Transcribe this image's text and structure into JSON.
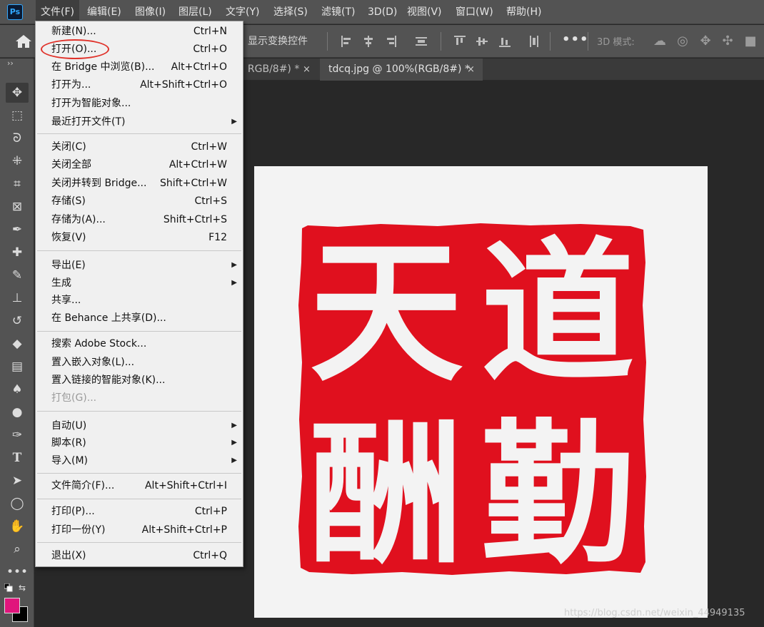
{
  "app": {
    "logo_text": "Ps"
  },
  "menubar": {
    "items": [
      "文件(F)",
      "编辑(E)",
      "图像(I)",
      "图层(L)",
      "文字(Y)",
      "选择(S)",
      "滤镜(T)",
      "3D(D)",
      "视图(V)",
      "窗口(W)",
      "帮助(H)"
    ],
    "active": "文件(F)"
  },
  "options_bar": {
    "transform_controls_label": "显示变换控件",
    "mode_label": "3D 模式:",
    "more": "•••"
  },
  "tabs": [
    {
      "label": ", RGB/8#) *",
      "close": "×"
    },
    {
      "label": "tdcq.jpg @ 100%(RGB/8#) *",
      "close": "×"
    }
  ],
  "file_menu": {
    "groups": [
      [
        {
          "label": "新建(N)...",
          "shortcut": "Ctrl+N"
        },
        {
          "label": "打开(O)...",
          "shortcut": "Ctrl+O",
          "highlighted": true
        },
        {
          "label": "在 Bridge 中浏览(B)...",
          "shortcut": "Alt+Ctrl+O"
        },
        {
          "label": "打开为...",
          "shortcut": "Alt+Shift+Ctrl+O"
        },
        {
          "label": "打开为智能对象..."
        },
        {
          "label": "最近打开文件(T)",
          "submenu": true
        }
      ],
      [
        {
          "label": "关闭(C)",
          "shortcut": "Ctrl+W"
        },
        {
          "label": "关闭全部",
          "shortcut": "Alt+Ctrl+W"
        },
        {
          "label": "关闭并转到 Bridge...",
          "shortcut": "Shift+Ctrl+W"
        },
        {
          "label": "存储(S)",
          "shortcut": "Ctrl+S"
        },
        {
          "label": "存储为(A)...",
          "shortcut": "Shift+Ctrl+S"
        },
        {
          "label": "恢复(V)",
          "shortcut": "F12"
        }
      ],
      [
        {
          "label": "导出(E)",
          "submenu": true
        },
        {
          "label": "生成",
          "submenu": true
        },
        {
          "label": "共享..."
        },
        {
          "label": "在 Behance 上共享(D)..."
        }
      ],
      [
        {
          "label": "搜索 Adobe Stock..."
        },
        {
          "label": "置入嵌入对象(L)..."
        },
        {
          "label": "置入链接的智能对象(K)..."
        },
        {
          "label": "打包(G)...",
          "disabled": true
        }
      ],
      [
        {
          "label": "自动(U)",
          "submenu": true
        },
        {
          "label": "脚本(R)",
          "submenu": true
        },
        {
          "label": "导入(M)",
          "submenu": true
        }
      ],
      [
        {
          "label": "文件简介(F)...",
          "shortcut": "Alt+Shift+Ctrl+I"
        }
      ],
      [
        {
          "label": "打印(P)...",
          "shortcut": "Ctrl+P"
        },
        {
          "label": "打印一份(Y)",
          "shortcut": "Alt+Shift+Ctrl+P"
        }
      ],
      [
        {
          "label": "退出(X)",
          "shortcut": "Ctrl+Q"
        }
      ]
    ],
    "submenu_arrow": "▶"
  },
  "toolbar": {
    "grip": "››",
    "tools": [
      "move-tool",
      "marquee-tool",
      "lasso-tool",
      "quick-select-tool",
      "crop-tool",
      "frame-tool",
      "eyedropper-tool",
      "healing-brush-tool",
      "brush-tool",
      "clone-stamp-tool",
      "history-brush-tool",
      "eraser-tool",
      "gradient-tool",
      "blur-tool",
      "dodge-tool",
      "pen-tool",
      "type-tool",
      "path-select-tool",
      "ellipse-tool",
      "hand-tool",
      "zoom-tool",
      "more-tools"
    ],
    "foreground_color": "#e0157c",
    "background_color": "#000000"
  },
  "document": {
    "seal_chars": [
      "天",
      "道",
      "酬",
      "勤"
    ],
    "seal_color": "#e0101e"
  },
  "watermark": "https://blog.csdn.net/weixin_44949135"
}
